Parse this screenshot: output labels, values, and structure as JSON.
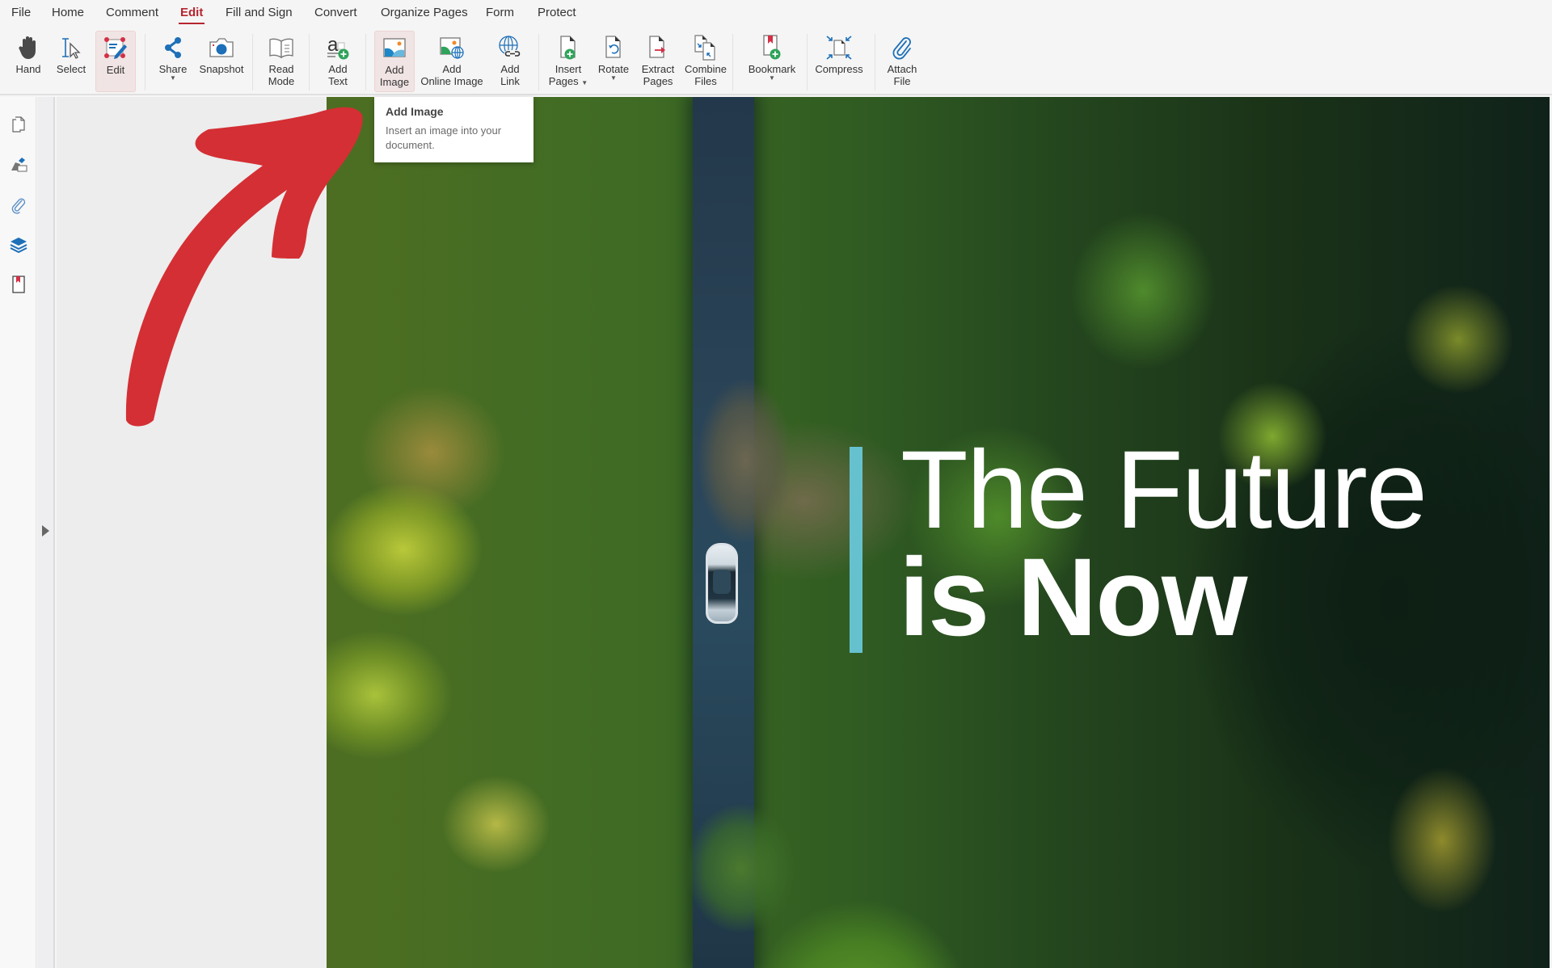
{
  "menu": {
    "items": [
      {
        "label": "File"
      },
      {
        "label": "Home"
      },
      {
        "label": "Comment"
      },
      {
        "label": "Edit",
        "active": true
      },
      {
        "label": "Fill and Sign"
      },
      {
        "label": "Convert"
      },
      {
        "label": "Organize Pages"
      },
      {
        "label": "Form"
      },
      {
        "label": "Protect"
      }
    ]
  },
  "ribbon": {
    "buttons": [
      {
        "label": "Hand",
        "icon": "hand-icon"
      },
      {
        "label": "Select",
        "icon": "select-cursor-icon"
      },
      {
        "label": "Edit",
        "icon": "edit-pen-icon",
        "selected": true
      },
      {
        "label": "Share",
        "icon": "share-icon",
        "has_dropdown": true
      },
      {
        "label": "Snapshot",
        "icon": "camera-icon"
      },
      {
        "label": "Read\nMode",
        "line1": "Read",
        "line2": "Mode",
        "icon": "book-icon"
      },
      {
        "label": "Add Text",
        "line1": "Add",
        "line2": "Text",
        "icon": "add-text-icon"
      },
      {
        "label": "Add Image",
        "line1": "Add",
        "line2": "Image",
        "icon": "image-icon",
        "selected": true
      },
      {
        "label": "Add Online Image",
        "line1": "Add",
        "line2": "Online Image",
        "icon": "online-image-icon"
      },
      {
        "label": "Add Link",
        "line1": "Add",
        "line2": "Link",
        "icon": "link-icon"
      },
      {
        "label": "Insert Pages",
        "line1": "Insert",
        "line2": "Pages",
        "icon": "insert-page-icon",
        "has_dropdown": true
      },
      {
        "label": "Rotate",
        "icon": "rotate-page-icon",
        "has_dropdown": true
      },
      {
        "label": "Extract Pages",
        "line1": "Extract",
        "line2": "Pages",
        "icon": "extract-page-icon"
      },
      {
        "label": "Combine Files",
        "line1": "Combine",
        "line2": "Files",
        "icon": "combine-files-icon"
      },
      {
        "label": "Bookmark",
        "icon": "bookmark-add-icon",
        "has_dropdown": true
      },
      {
        "label": "Compress",
        "icon": "compress-icon"
      },
      {
        "label": "Attach File",
        "line1": "Attach",
        "line2": "File",
        "icon": "paperclip-icon"
      }
    ]
  },
  "sidebar": {
    "icons": [
      "pages-icon",
      "signature-icon",
      "attachment-icon",
      "layers-icon",
      "bookmark-icon"
    ]
  },
  "tooltip": {
    "title": "Add Image",
    "body": "Insert an image into your document."
  },
  "document": {
    "headline_line1": "The Future",
    "headline_line2": "is Now",
    "accent_color": "#66c1cf"
  },
  "colors": {
    "active_tab": "#b5252e",
    "annotation_arrow": "#d42f34",
    "icon_blue": "#1d6fb8"
  }
}
